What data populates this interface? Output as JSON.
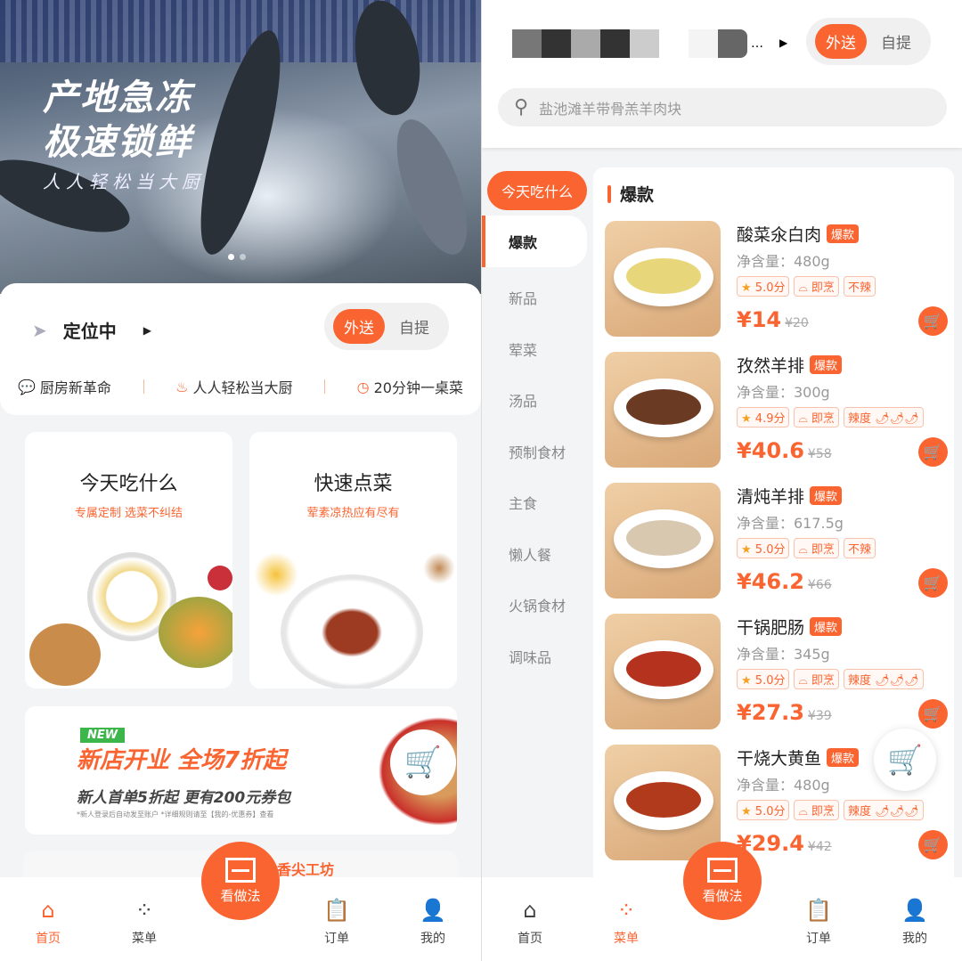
{
  "accent": "#fa6430",
  "home": {
    "banner": {
      "line1": "产地急冻",
      "line2": "极速锁鲜",
      "sub": "人人轻松当大厨"
    },
    "location": "定位中",
    "delivery_toggle": {
      "options": [
        "外送",
        "自提"
      ],
      "selected": "外送"
    },
    "features": [
      {
        "icon": "chat-icon",
        "label": "厨房新革命"
      },
      {
        "icon": "chef-hat-icon",
        "label": "人人轻松当大厨"
      },
      {
        "icon": "clock-icon",
        "label": "20分钟一桌菜"
      }
    ],
    "cards": [
      {
        "title": "今天吃什么",
        "subtitle": "专属定制 选菜不纠结"
      },
      {
        "title": "快速点菜",
        "subtitle": "荤素凉热应有尽有"
      }
    ],
    "promo": {
      "badge": "NEW",
      "headline": "新店开业 全场7折起",
      "sub": "新人首单5折起 更有200元券包",
      "fine_print": "*新人登录后自动发至账户    *详细规则请至【我的-优惠券】查看"
    },
    "partial_card_text": "香尖工坊",
    "scan_button": "看做法",
    "nav": [
      {
        "icon": "home-icon",
        "label": "首页",
        "active": true
      },
      {
        "icon": "grid-icon",
        "label": "菜单",
        "active": false
      },
      {
        "icon": "clipboard-icon",
        "label": "订单",
        "active": false
      },
      {
        "icon": "user-icon",
        "label": "我的",
        "active": false
      }
    ]
  },
  "menu": {
    "delivery_toggle": {
      "options": [
        "外送",
        "自提"
      ],
      "selected": "外送"
    },
    "search_placeholder": "盐池滩羊带骨羔羊肉块",
    "today_button": "今天吃什么",
    "categories": [
      "爆款",
      "新品",
      "荤菜",
      "汤品",
      "预制食材",
      "主食",
      "懒人餐",
      "火锅食材",
      "调味品"
    ],
    "active_category": "爆款",
    "section_title": "爆款",
    "items": [
      {
        "name": "酸菜氽白肉",
        "badge": "爆款",
        "net": "净含量：480g",
        "rating": "5.0分",
        "cook": "即烹",
        "spice": "不辣",
        "price": "¥14",
        "old_price": "¥20"
      },
      {
        "name": "孜然羊排",
        "badge": "爆款",
        "net": "净含量：300g",
        "rating": "4.9分",
        "cook": "即烹",
        "spice": "辣度 🌶🌶🌶",
        "price": "¥40.6",
        "old_price": "¥58"
      },
      {
        "name": "清炖羊排",
        "badge": "爆款",
        "net": "净含量：617.5g",
        "rating": "5.0分",
        "cook": "即烹",
        "spice": "不辣",
        "price": "¥46.2",
        "old_price": "¥66"
      },
      {
        "name": "干锅肥肠",
        "badge": "爆款",
        "net": "净含量：345g",
        "rating": "5.0分",
        "cook": "即烹",
        "spice": "辣度 🌶🌶🌶",
        "price": "¥27.3",
        "old_price": "¥39"
      },
      {
        "name": "干烧大黄鱼",
        "badge": "爆款",
        "net": "净含量：480g",
        "rating": "5.0分",
        "cook": "即烹",
        "spice": "辣度 🌶🌶🌶",
        "price": "¥29.4",
        "old_price": "¥42"
      }
    ],
    "scan_button": "看做法",
    "nav": [
      {
        "icon": "home-icon",
        "label": "首页",
        "active": false
      },
      {
        "icon": "grid-icon",
        "label": "菜单",
        "active": true
      },
      {
        "icon": "clipboard-icon",
        "label": "订单",
        "active": false
      },
      {
        "icon": "user-icon",
        "label": "我的",
        "active": false
      }
    ]
  }
}
